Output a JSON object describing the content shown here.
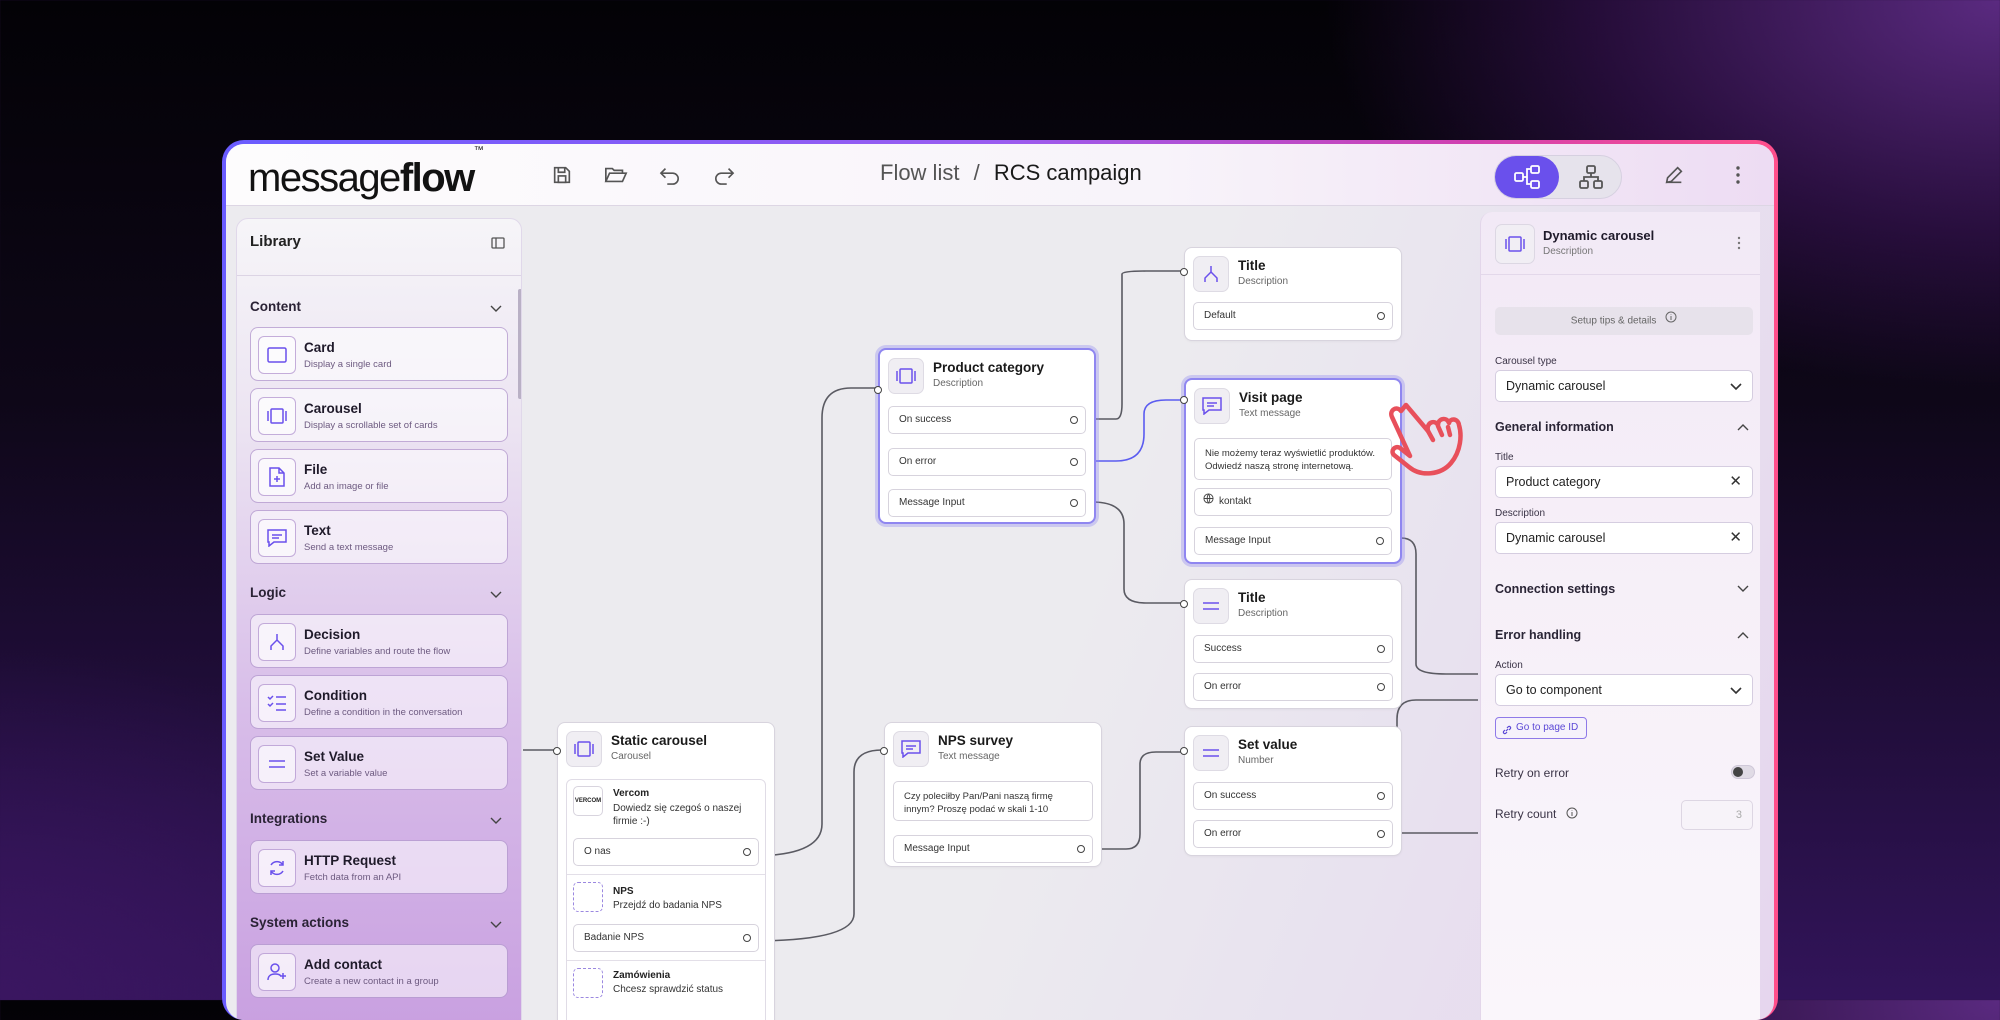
{
  "app": {
    "logo_light": "message",
    "logo_bold": "flow",
    "logo_tm": "™"
  },
  "breadcrumb": {
    "root": "Flow list",
    "sep": "/",
    "current": "RCS campaign"
  },
  "library": {
    "title": "Library",
    "sections": [
      {
        "label": "Content",
        "items": [
          {
            "name": "Card",
            "desc": "Display a single card",
            "icon": "card-icon"
          },
          {
            "name": "Carousel",
            "desc": "Display a scrollable set of cards",
            "icon": "carousel-icon"
          },
          {
            "name": "File",
            "desc": "Add an image or file",
            "icon": "file-icon"
          },
          {
            "name": "Text",
            "desc": "Send a text message",
            "icon": "chat-icon"
          }
        ]
      },
      {
        "label": "Logic",
        "items": [
          {
            "name": "Decision",
            "desc": "Define variables and route the flow",
            "icon": "branch-icon"
          },
          {
            "name": "Condition",
            "desc": "Define a condition in the conversation",
            "icon": "checklist-icon"
          },
          {
            "name": "Set Value",
            "desc": "Set a variable value",
            "icon": "equals-icon"
          }
        ]
      },
      {
        "label": "Integrations",
        "items": [
          {
            "name": "HTTP Request",
            "desc": "Fetch data from an API",
            "icon": "refresh-icon"
          }
        ]
      },
      {
        "label": "System actions",
        "items": [
          {
            "name": "Add contact",
            "desc": "Create a new contact in a group",
            "icon": "add-user-icon"
          }
        ]
      }
    ]
  },
  "nodes": {
    "decision_top": {
      "title": "Title",
      "subtitle": "Description",
      "rows": [
        "Default"
      ]
    },
    "product_category": {
      "title": "Product category",
      "subtitle": "Description",
      "rows": [
        "On success",
        "On error",
        "Message Input"
      ]
    },
    "visit_page": {
      "title": "Visit page",
      "subtitle": "Text message",
      "message": "Nie możemy teraz wyświetlić produktów. Odwiedź naszą stronę internetową.",
      "link": "kontakt",
      "rows": [
        "Message Input"
      ]
    },
    "title_mid": {
      "title": "Title",
      "subtitle": "Description",
      "rows": [
        "Success",
        "On error"
      ]
    },
    "static_carousel": {
      "title": "Static carousel",
      "subtitle": "Carousel",
      "cards": [
        {
          "brand": "VERCOM",
          "name": "Vercom",
          "text": "Dowiedz się czegoś o naszej firmie :-)",
          "button": "O nas"
        },
        {
          "name": "NPS",
          "text": "Przejdź do badania NPS",
          "button": "Badanie NPS"
        },
        {
          "name": "Zamówienia",
          "text": "Chcesz sprawdzić status"
        }
      ]
    },
    "nps_survey": {
      "title": "NPS survey",
      "subtitle": "Text message",
      "message": "Czy poleciłby Pan/Pani naszą firmę innym? Proszę podać w skali 1-10",
      "rows": [
        "Message Input"
      ]
    },
    "set_value": {
      "title": "Set value",
      "subtitle": "Number",
      "rows": [
        "On success",
        "On error"
      ]
    }
  },
  "panel": {
    "title": "Dynamic carousel",
    "subtitle": "Description",
    "tips": "Setup tips & details",
    "carousel_type_label": "Carousel type",
    "carousel_type_value": "Dynamic carousel",
    "general_info": "General information",
    "title_label": "Title",
    "title_value": "Product category",
    "desc_label": "Description",
    "desc_value": "Dynamic carousel",
    "connection_settings": "Connection settings",
    "error_handling": "Error handling",
    "action_label": "Action",
    "action_value": "Go to component",
    "go_to_page": "Go to page ID",
    "retry_on_error": "Retry on error",
    "retry_count_label": "Retry count",
    "retry_count_value": "3"
  },
  "colors": {
    "accent": "#6a50ec",
    "selected_border": "#8f86f0",
    "cursor": "#e8505b"
  }
}
